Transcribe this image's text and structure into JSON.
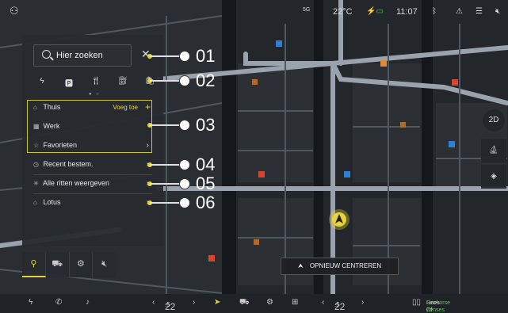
{
  "status_bar": {
    "signal": "5G",
    "temperature": "22°C",
    "battery_icon": "battery-charging-icon",
    "battery_text": "",
    "time": "11:07",
    "icons": [
      "user-icon",
      "bluetooth-icon",
      "alert-icon",
      "settings-sliders-icon",
      "volume-mute-icon"
    ]
  },
  "search": {
    "placeholder": "Hier zoeken"
  },
  "categories": [
    "charging-icon",
    "parking-icon",
    "restaurant-icon",
    "fuel-icon",
    "shopping-icon"
  ],
  "favorites": {
    "home_label": "Thuis",
    "add_label": "Voeg toe",
    "work_label": "Werk",
    "favorites_label": "Favorieten"
  },
  "menu": {
    "recent_label": "Recent bestem.",
    "all_rides_label": "Alle ritten weergeven",
    "lotus_label": "Lotus"
  },
  "callouts": [
    "01",
    "02",
    "03",
    "04",
    "05",
    "06"
  ],
  "map": {
    "view_mode": "2D",
    "recenter_label": "OPNIEUW CENTREREN"
  },
  "dock": {
    "left_temp_value": "22",
    "left_temp_decimal": ".5",
    "right_temp_value": "22",
    "right_temp_decimal": ".5",
    "media_title": "Lines Of My Mind",
    "media_artist": "Seahorse Zenses"
  },
  "colors": {
    "accent": "#e8d33a",
    "panel": "#282c30",
    "map_bg": "#1a1d21"
  }
}
